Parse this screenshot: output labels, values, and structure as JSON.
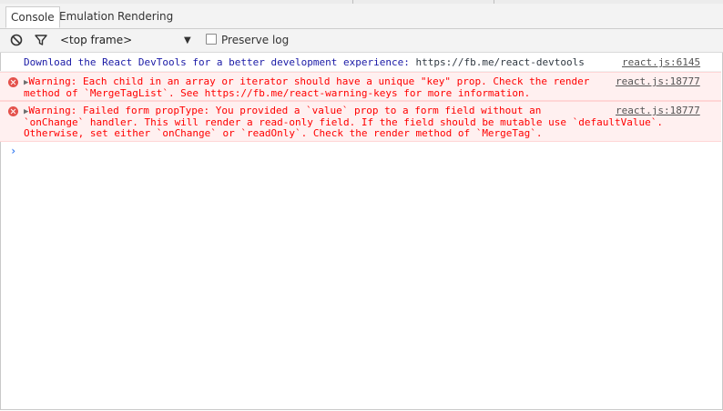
{
  "tabs": [
    {
      "label": "Console",
      "active": true
    },
    {
      "label": "Emulation",
      "active": false
    },
    {
      "label": "Rendering",
      "active": false
    }
  ],
  "toolbar": {
    "clear_icon": "clear-console-icon",
    "filter_icon": "filter-icon",
    "frame_select": "<top frame>",
    "preserve_log_label": "Preserve log",
    "preserve_log_checked": false
  },
  "messages": [
    {
      "level": "info",
      "text": "Download the React DevTools for a better development experience: ",
      "link": "https://fb.me/react-devtools",
      "source": "react.js:6145"
    },
    {
      "level": "error",
      "lines": [
        "Warning: Each child in an array or iterator should have a unique \"key\" prop. Check the render",
        "method of `MergeTagList`. See https://fb.me/react-warning-keys for more information."
      ],
      "source": "react.js:18777"
    },
    {
      "level": "error",
      "lines": [
        "Warning: Failed form propType: You provided a `value` prop to a form field without an",
        "`onChange` handler. This will render a read-only field. If the field should be mutable use `defaultValue`.",
        "Otherwise, set either `onChange` or `readOnly`. Check the render method of `MergeTag`."
      ],
      "source": "react.js:18777"
    }
  ],
  "colors": {
    "error_text": "#ff0000",
    "error_bg": "#fff0f0",
    "info_text": "#1a1aa6",
    "prompt": "#367cf1"
  }
}
